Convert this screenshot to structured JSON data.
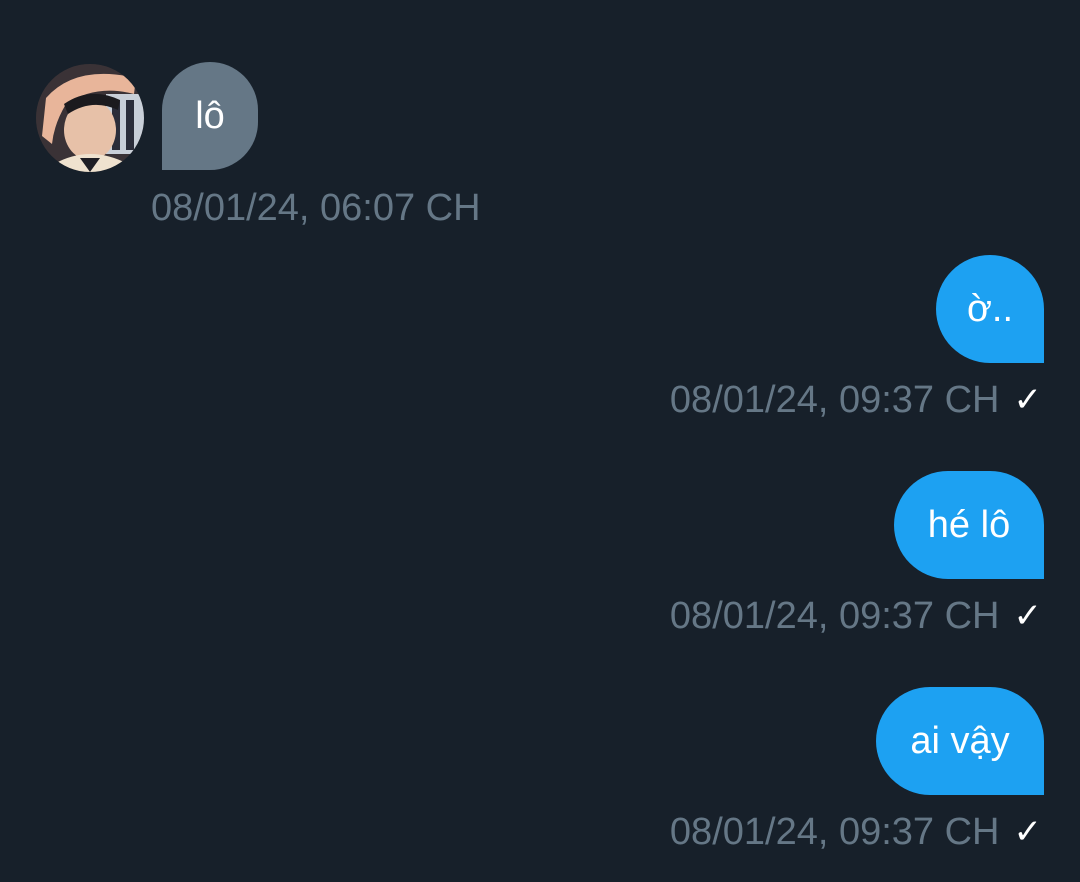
{
  "messages": [
    {
      "direction": "incoming",
      "text": "lô",
      "timestamp": "08/01/24, 06:07 CH"
    },
    {
      "direction": "outgoing",
      "text": "ờ..",
      "timestamp": "08/01/24, 09:37 CH",
      "status_icon": "check-icon"
    },
    {
      "direction": "outgoing",
      "text": "hé lô",
      "timestamp": "08/01/24, 09:37 CH",
      "status_icon": "check-icon"
    },
    {
      "direction": "outgoing",
      "text": "ai vậy",
      "timestamp": "08/01/24, 09:37 CH",
      "status_icon": "check-icon"
    }
  ],
  "colors": {
    "background": "#17202a",
    "incoming_bubble": "#657786",
    "outgoing_bubble": "#1da1f2",
    "timestamp_text": "#657786",
    "message_text": "#ffffff"
  },
  "icons": {
    "check": "✓"
  }
}
